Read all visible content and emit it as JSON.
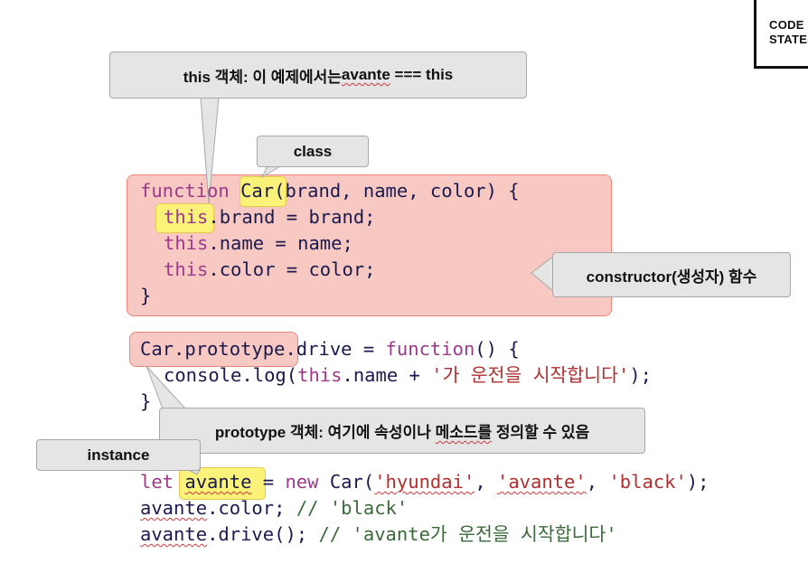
{
  "logo": {
    "line1": "CODE",
    "line2": "STATES"
  },
  "callouts": {
    "this_object": {
      "prefix": "this 객체: 이 예제에서는 ",
      "highlight": "avante",
      "suffix": " === this"
    },
    "class": "class",
    "constructor": "constructor(생성자) 함수",
    "prototype_object": {
      "prefix": "prototype 객체: 여기에 속성이나 ",
      "highlight": "메소드를",
      "suffix": " 정의할 수 있음"
    },
    "instance": "instance"
  },
  "code": {
    "l1": {
      "kw": "function",
      "name": "Car",
      "rest": "(brand, name, color) {"
    },
    "l2": {
      "kw": "this",
      "rest": ".brand = brand;"
    },
    "l3": {
      "kw": "this",
      "rest": ".name = name;"
    },
    "l4": {
      "kw": "this",
      "rest": ".color = color;"
    },
    "l5": "}",
    "l6": {
      "obj": "Car.prototype",
      "mid": ".drive = ",
      "kw": "function",
      "rest": "() {"
    },
    "l7": {
      "pre": "console.log(",
      "kw": "this",
      "mid": ".name + ",
      "str": "'가 운전을 시작합니다'",
      "end": ");"
    },
    "l8": "}",
    "l9": {
      "kw": "let",
      "var": "avante",
      "mid": " = ",
      "kw2": "new",
      "call": " Car(",
      "s1": "'hyundai'",
      "c1": ", ",
      "s2": "'avante'",
      "c2": ", ",
      "s3": "'black'",
      "end": ");"
    },
    "l10": {
      "var": "avante",
      "rest": ".color; ",
      "cm": "// 'black'"
    },
    "l11": {
      "var": "avante",
      "rest": ".drive(); ",
      "cm": "// 'avante가 운전을 시작합니다'"
    }
  }
}
